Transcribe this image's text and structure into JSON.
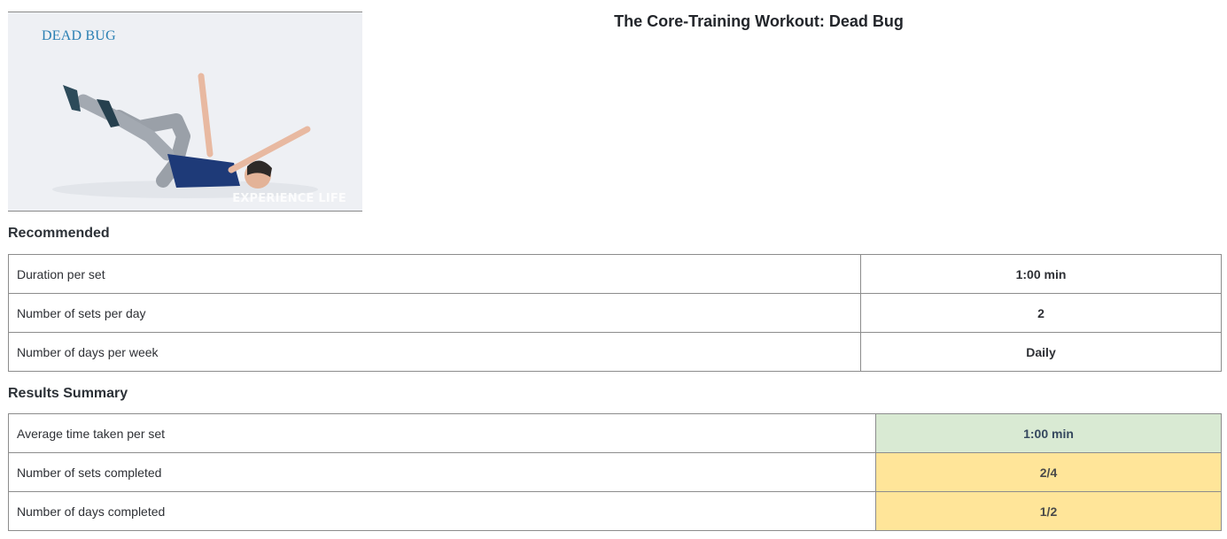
{
  "hero": {
    "caption": "DEAD BUG",
    "watermark": "EXPERIENCE LIFE",
    "image_alt": "Person lying on back performing dead bug exercise"
  },
  "page_title": "The Core-Training Workout: Dead Bug",
  "recommended": {
    "heading": "Recommended",
    "rows": [
      {
        "label": "Duration per set",
        "value": "1:00 min"
      },
      {
        "label": "Number of sets per day",
        "value": "2"
      },
      {
        "label": "Number of days per week",
        "value": "Daily"
      }
    ]
  },
  "results": {
    "heading": "Results Summary",
    "rows": [
      {
        "label": "Average time taken per set",
        "value": "1:00 min",
        "status_color": "#d9ead3"
      },
      {
        "label": "Number of sets completed",
        "value": "2/4",
        "status_color": "#ffe599"
      },
      {
        "label": "Number of days completed",
        "value": "1/2",
        "status_color": "#ffe599"
      }
    ]
  }
}
